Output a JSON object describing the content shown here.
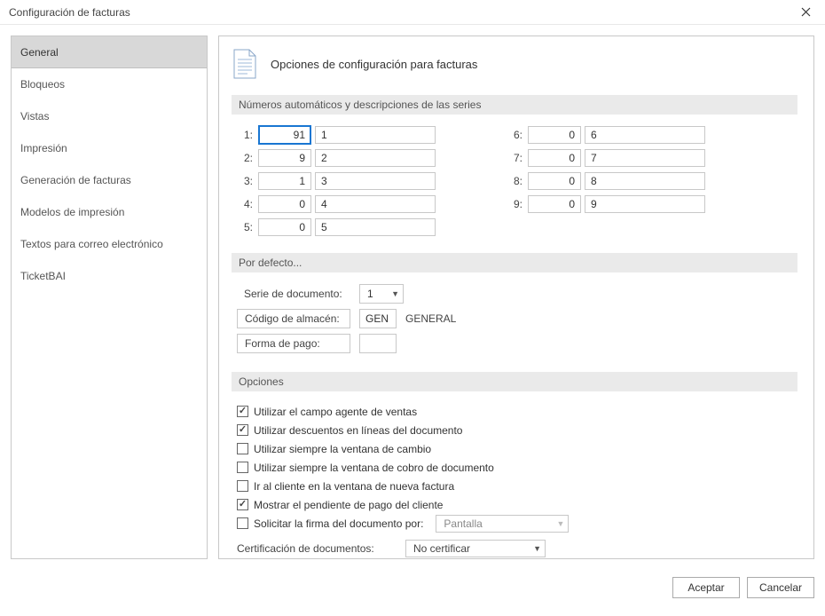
{
  "window_title": "Configuración de facturas",
  "sidebar": {
    "items": [
      {
        "label": "General",
        "selected": true
      },
      {
        "label": "Bloqueos",
        "selected": false
      },
      {
        "label": "Vistas",
        "selected": false
      },
      {
        "label": "Impresión",
        "selected": false
      },
      {
        "label": "Generación de facturas",
        "selected": false
      },
      {
        "label": "Modelos de impresión",
        "selected": false
      },
      {
        "label": "Textos para correo electrónico",
        "selected": false
      },
      {
        "label": "TicketBAI",
        "selected": false
      }
    ]
  },
  "content": {
    "header_title": "Opciones de configuración para facturas",
    "section_series_title": "Números automáticos y descripciones de las series",
    "series_left": [
      {
        "label": "1:",
        "num": "91",
        "desc": "1",
        "focused": true
      },
      {
        "label": "2:",
        "num": "9",
        "desc": "2",
        "focused": false
      },
      {
        "label": "3:",
        "num": "1",
        "desc": "3",
        "focused": false
      },
      {
        "label": "4:",
        "num": "0",
        "desc": "4",
        "focused": false
      },
      {
        "label": "5:",
        "num": "0",
        "desc": "5",
        "focused": false
      }
    ],
    "series_right": [
      {
        "label": "6:",
        "num": "0",
        "desc": "6"
      },
      {
        "label": "7:",
        "num": "0",
        "desc": "7"
      },
      {
        "label": "8:",
        "num": "0",
        "desc": "8"
      },
      {
        "label": "9:",
        "num": "0",
        "desc": "9"
      }
    ],
    "section_defaults_title": "Por defecto...",
    "defaults": {
      "doc_series_label": "Serie de documento:",
      "doc_series_value": "1",
      "warehouse_label": "Código de almacén:",
      "warehouse_code": "GEN",
      "warehouse_desc": "GENERAL",
      "payment_label": "Forma de pago:",
      "payment_value": ""
    },
    "section_options_title": "Opciones",
    "options": [
      {
        "checked": true,
        "label": "Utilizar el campo agente de ventas"
      },
      {
        "checked": true,
        "label": "Utilizar descuentos en líneas del documento"
      },
      {
        "checked": false,
        "label": "Utilizar siempre la ventana de cambio"
      },
      {
        "checked": false,
        "label": "Utilizar siempre la ventana de cobro de documento"
      },
      {
        "checked": false,
        "label": "Ir al cliente en la ventana de nueva factura"
      },
      {
        "checked": true,
        "label": "Mostrar el pendiente de pago del cliente"
      }
    ],
    "sign_row": {
      "checked": false,
      "label": "Solicitar la firma del documento por:",
      "combo_value": "Pantalla"
    },
    "cert_row": {
      "label": "Certificación de documentos:",
      "combo_value": "No certificar"
    }
  },
  "footer": {
    "accept_label": "Aceptar",
    "cancel_label": "Cancelar"
  }
}
